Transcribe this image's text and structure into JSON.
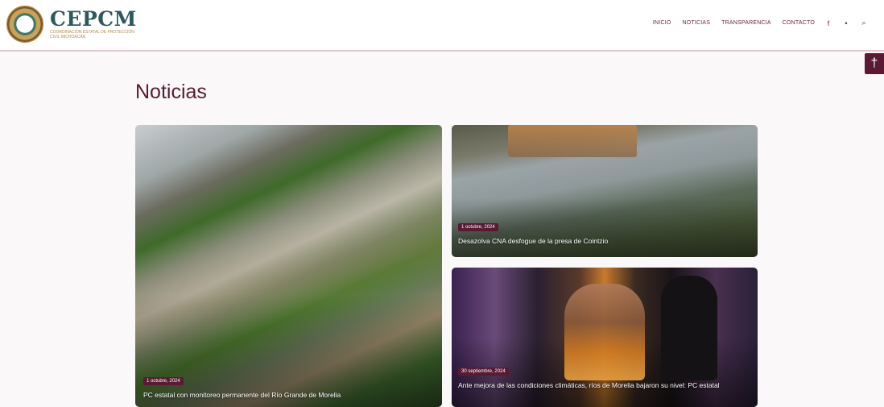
{
  "brand": {
    "title": "CEPCM",
    "subtitle": "COORDINACIÓN ESTATAL DE PROTECCIÓN CIVIL MICHOACÁN"
  },
  "nav": {
    "items": [
      "INICIO",
      "NOTICIAS",
      "TRANSPARENCIA",
      "CONTACTO"
    ],
    "facebook_icon": "f",
    "twitter_icon": "•",
    "search_icon": "⌕"
  },
  "accessibility": {
    "icon": "†"
  },
  "page": {
    "title": "Noticias"
  },
  "news": [
    {
      "date": "1 octubre, 2024",
      "headline": "PC estatal con monitoreo permanente del Río Grande de Morelia"
    },
    {
      "date": "1 octubre, 2024",
      "headline": "Desazolva CNA desfogue de la presa de Cointzio"
    },
    {
      "date": "30 septiembre, 2024",
      "headline": "Ante mejora de las condiciones climáticas, ríos de Morelia bajaron su nivel: PC estatal"
    }
  ],
  "colors": {
    "primary": "#5a1a34",
    "brand_text": "#2c5a5c",
    "accent_line": "#e8c5d3"
  }
}
